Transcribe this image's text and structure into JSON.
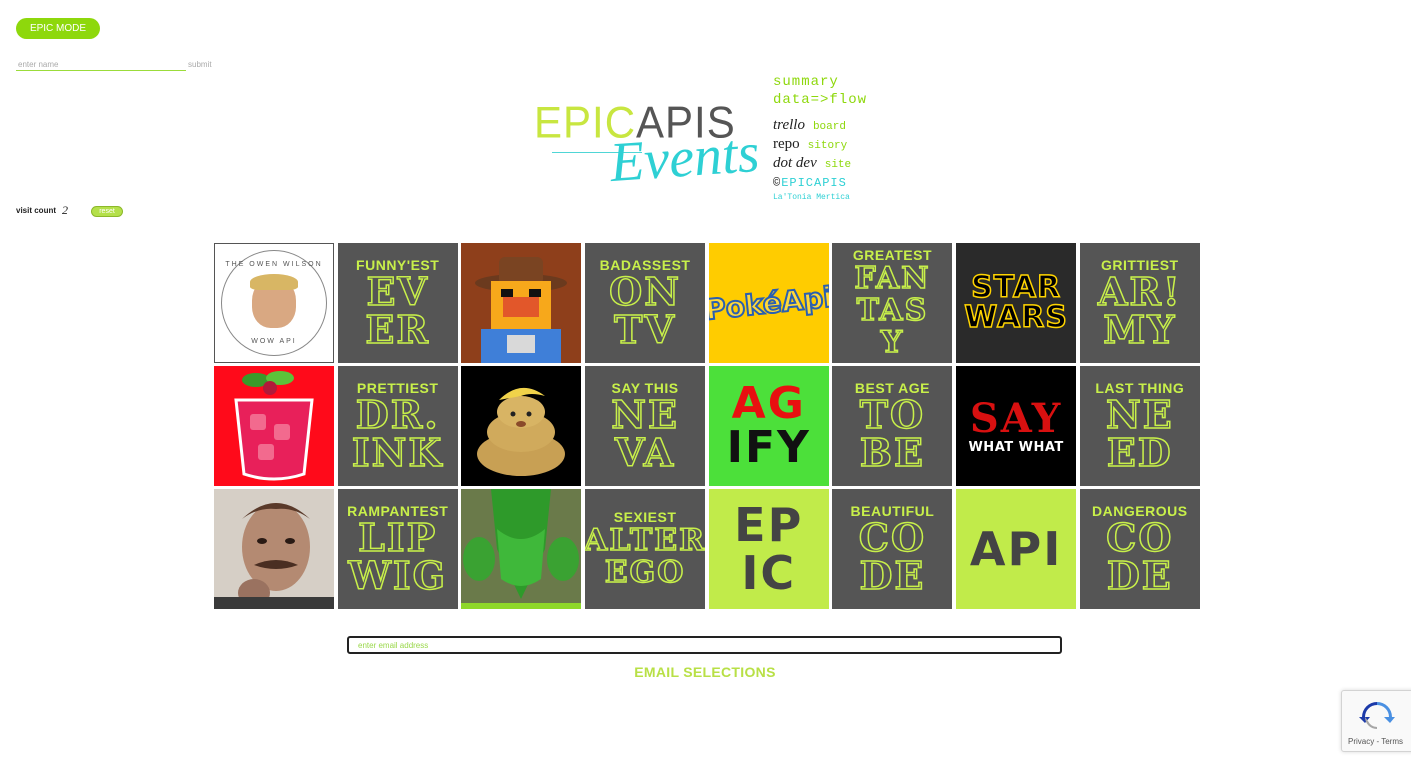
{
  "controls": {
    "epic_mode_label": "EPIC MODE",
    "name_placeholder": "enter name",
    "submit_label": "submit",
    "visit_count_label": "visit count",
    "visit_count_value": "2",
    "reset_label": "reset"
  },
  "logo": {
    "epic": "EPIC",
    "apis": "APIS",
    "events": "Events"
  },
  "info": {
    "summary": "summary",
    "dataflow": "data=>flow",
    "links": [
      {
        "a": "trello",
        "b": "board"
      },
      {
        "a": "repo",
        "b": "sitory"
      },
      {
        "a": "dot dev",
        "b": "site"
      }
    ],
    "copyright_symbol": "©",
    "copyright_brand": "EPICAPIS",
    "author": "La'Tonia Mertica"
  },
  "tiles": [
    {
      "top": "THE OWEN WILSON",
      "bottom": "WOW API"
    },
    {
      "top": "FUNNY'EST",
      "line1": "EV",
      "line2": "ER"
    },
    {},
    {
      "top": "BADASSEST",
      "line1": "ON",
      "line2": "TV"
    },
    {
      "text": "PokéApi"
    },
    {
      "top": "GREATEST",
      "line1": "FAN",
      "line2": "TAS",
      "line3": "Y"
    },
    {
      "line1": "STAR",
      "line2": "WARS"
    },
    {
      "top": "GRITTIEST",
      "line1": "AR!",
      "line2": "MY"
    },
    {},
    {
      "top": "PRETTIEST",
      "line1": "DR.",
      "line2": "INK"
    },
    {},
    {
      "top": "SAY THIS",
      "line1": "NE",
      "line2": "VA"
    },
    {
      "line1": "AG",
      "line2": "IFY"
    },
    {
      "top": "BEST AGE",
      "line1": "TO",
      "line2": "BE"
    },
    {
      "line1": "SAY",
      "line2": "WHAT WHAT"
    },
    {
      "top": "LAST THING",
      "line1": "NE",
      "line2": "ED"
    },
    {},
    {
      "top": "RAMPANTEST",
      "line1": "LIP",
      "line2": "WIG"
    },
    {},
    {
      "top": "SEXIEST",
      "line1": "ALTER",
      "line2": "EGO"
    },
    {
      "line1": "EP",
      "line2": "IC"
    },
    {
      "top": "BEAUTIFUL",
      "line1": "CO",
      "line2": "DE"
    },
    {
      "line1": "API"
    },
    {
      "top": "DANGEROUS",
      "line1": "CO",
      "line2": "DE"
    }
  ],
  "email": {
    "placeholder": "enter email address",
    "button_label": "EMAIL SELECTIONS"
  },
  "recaptcha": {
    "privacy": "Privacy",
    "separator": "-",
    "terms": "Terms"
  },
  "colors": {
    "accent_green": "#8ed80c",
    "lime": "#c8f04a",
    "teal": "#2ed0d4",
    "tile_gray": "#555555"
  }
}
